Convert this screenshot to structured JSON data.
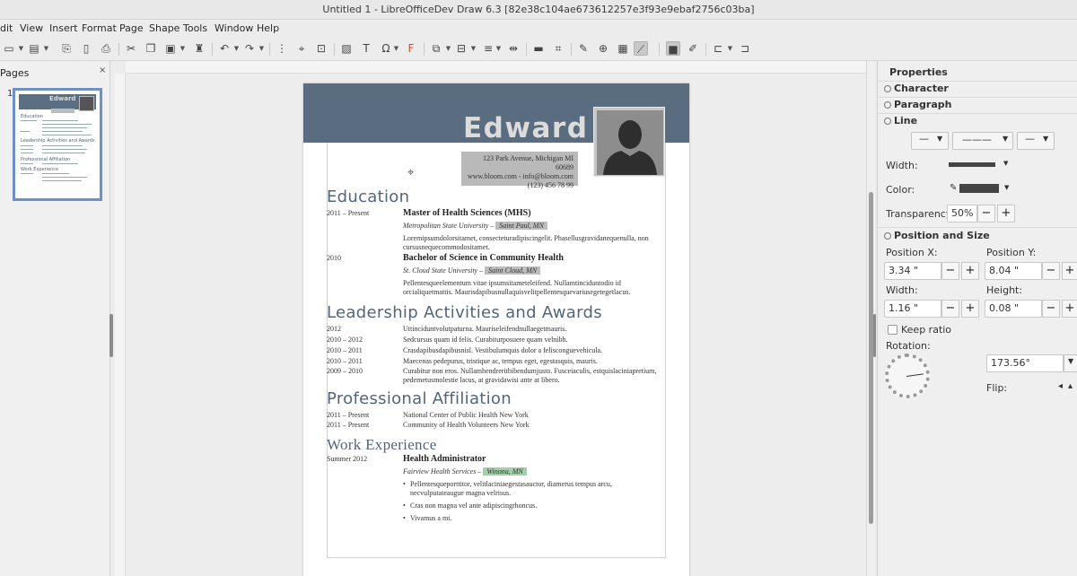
{
  "window": {
    "title": "Untitled 1 - LibreOfficeDev Draw 6.3 [82e38c104ae673612257e3f93e9ebaf2756c03ba]"
  },
  "menu": [
    "dit",
    "View",
    "Insert",
    "Format",
    "Page",
    "Shape",
    "Tools",
    "Window",
    "Help"
  ],
  "pages_panel": {
    "title": "Pages",
    "close": "×",
    "page_number": "1",
    "thumb": {
      "name": "Edward",
      "headings": [
        "Education",
        "Leadership Activities and Awards",
        "Professional Affiliation",
        "Work Experience"
      ]
    }
  },
  "resume": {
    "name": "Edward",
    "address": [
      "123 Park Avenue, Michigan MI 60689",
      "www.bloom.com - info@bloom.com",
      "(123) 456 78 99"
    ],
    "education": {
      "title": "Education",
      "entries": [
        {
          "date": "2011 – Present",
          "title": "Master of Health Sciences (MHS)",
          "school": "Metropolitan State University – ",
          "place": "Saint Paul, MN",
          "body": "Loremipsumdolorsitamet, consecteturadipiscingelit. Phasellusgravidanequenulla, non cursusnequecommodositamet."
        },
        {
          "date": "2010",
          "title": "Bachelor of Science in Community Health",
          "school": "St. Cloud State University – ",
          "place": "Saint Cloud, MN",
          "body": "Pellentesqueelementum vitae ipsumsitameteleifend. Nullamtinciduntodio id orcialiquetmattis. Maurisdapibusnullaquisvelitpellentesquevariusegetegetlacus."
        }
      ]
    },
    "leadership": {
      "title": "Leadership Activities and Awards",
      "rows": [
        {
          "date": "2012",
          "text": "Uttinciduntvolutpaturna. Mauriseleifendnullaegetmauris."
        },
        {
          "date": "2010 – 2012",
          "text": "Sedcursus quam id felis. Curabiturposuere quam velnibh."
        },
        {
          "date": "2010 – 2011",
          "text": "Crasdapibusdapibusnisl. Vestibulumquis dolor a felisconguevehicula."
        },
        {
          "date": "2010 – 2011",
          "text": "Maecenas pedepurus, tristique ac, tempus eget, egestasquis, mauris."
        },
        {
          "date": "2009 – 2010",
          "text": "Curabitur non eros. Nullamhendreritbibendumjusto. Fusceiaculis, estquislaciniapretium, pedemetusmolestie lacus, at gravidawisi ante at libero."
        }
      ]
    },
    "affiliation": {
      "title": "Professional Affiliation",
      "rows": [
        {
          "date": "2011 – Present",
          "text": "National Center of Public Health New York"
        },
        {
          "date": "2011 – Present",
          "text": "Community of Health Volunteers New York"
        }
      ]
    },
    "work": {
      "title": "Work Experience",
      "date": "Summer 2012",
      "job": "Health Administrator",
      "company": "Fairview Health Services – ",
      "place": "Winona, MN",
      "bullets": [
        "Pellentesqueporttitor, velitlaciniaegestasauctor, diamerus tempus arcu, necvulputateaugue magna velrisus.",
        "Cras non magna vel ante adipiscingrhoncus.",
        "Vivamus a mi."
      ]
    }
  },
  "sidebar": {
    "title": "Properties",
    "sections": {
      "character": "Character",
      "paragraph": "Paragraph",
      "line": "Line",
      "position": "Position and Size"
    },
    "line": {
      "width_label": "Width:",
      "color_label": "Color:",
      "transparency_label": "Transparency:",
      "transparency_value": "50%"
    },
    "position": {
      "pos_x_label": "Position X:",
      "pos_x": "3.34 \"",
      "pos_y_label": "Position Y:",
      "pos_y": "8.04 \"",
      "width_label": "Width:",
      "width": "1.16 \"",
      "height_label": "Height:",
      "height": "0.08 \"",
      "keep_ratio": "Keep ratio",
      "rotation_label": "Rotation:",
      "rotation": "173.56°",
      "flip_label": "Flip:"
    },
    "colors": {
      "line_color": "#444444"
    }
  },
  "spin": {
    "minus": "−",
    "plus": "+"
  }
}
